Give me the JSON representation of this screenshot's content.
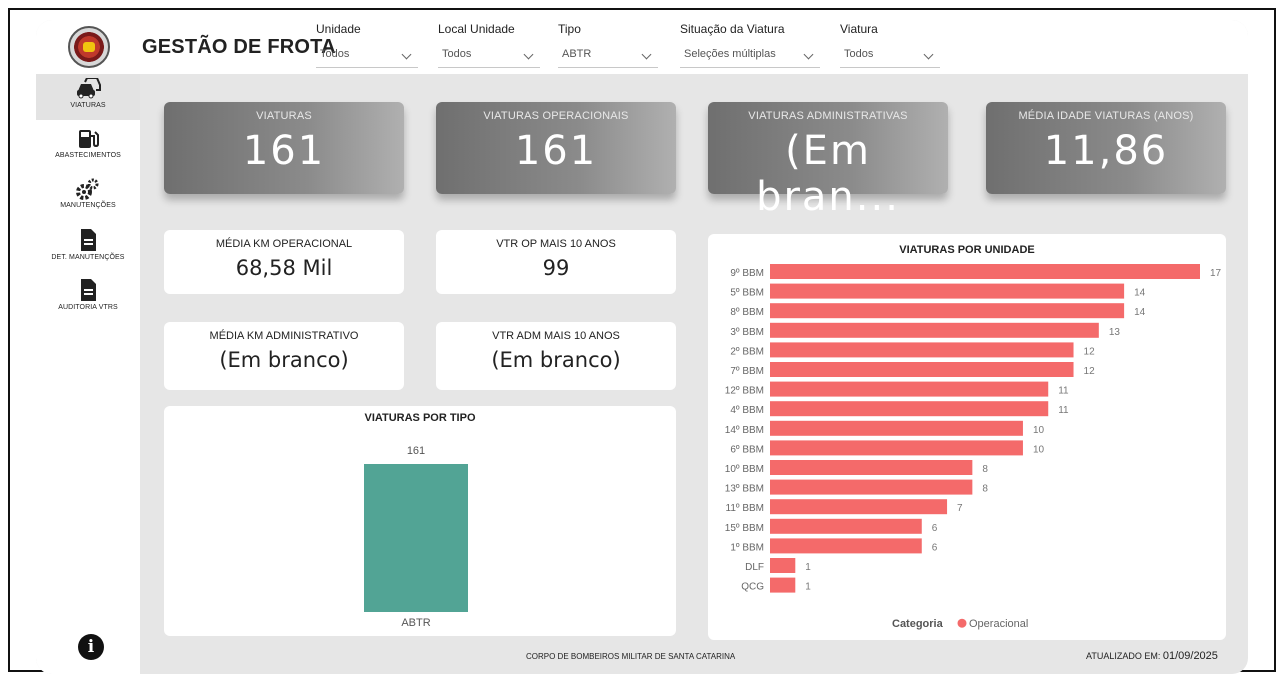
{
  "header": {
    "title": "GESTÃO DE FROTA",
    "filters": [
      {
        "label": "Unidade",
        "value": "Todos"
      },
      {
        "label": "Local Unidade",
        "value": "Todos"
      },
      {
        "label": "Tipo",
        "value": "ABTR"
      },
      {
        "label": "Situação da Viatura",
        "value": "Seleções múltiplas"
      },
      {
        "label": "Viatura",
        "value": "Todos"
      }
    ]
  },
  "sidebar": {
    "items": [
      {
        "label": "VIATURAS",
        "icon": "car-icon"
      },
      {
        "label": "ABASTECIMENTOS",
        "icon": "fuel-icon"
      },
      {
        "label": "MANUTENÇÕES",
        "icon": "gears-icon"
      },
      {
        "label": "DET. MANUTENÇÕES",
        "icon": "document-icon"
      },
      {
        "label": "AUDITORIA VTRS",
        "icon": "document-icon"
      }
    ],
    "info_icon": "info-icon"
  },
  "kpis": [
    {
      "label": "VIATURAS",
      "value": "161"
    },
    {
      "label": "VIATURAS OPERACIONAIS",
      "value": "161"
    },
    {
      "label": "VIATURAS ADMINISTRATIVAS",
      "value": "(Em bran..."
    },
    {
      "label": "MÉDIA IDADE VIATURAS (ANOS)",
      "value": "11,86"
    }
  ],
  "cards": [
    {
      "label": "MÉDIA KM OPERACIONAL",
      "value": "68,58 Mil"
    },
    {
      "label": "VTR OP MAIS 10 ANOS",
      "value": "99"
    },
    {
      "label": "MÉDIA KM ADMINISTRATIVO",
      "value": "(Em branco)"
    },
    {
      "label": "VTR ADM MAIS 10 ANOS",
      "value": "(Em branco)"
    }
  ],
  "chart_data": [
    {
      "type": "bar",
      "title": "VIATURAS POR TIPO",
      "categories": [
        "ABTR"
      ],
      "values": [
        161
      ],
      "color": "#52a495",
      "ylim": [
        0,
        161
      ]
    },
    {
      "type": "bar",
      "orientation": "horizontal",
      "title": "VIATURAS POR UNIDADE",
      "categories": [
        "9º BBM",
        "5º BBM",
        "8º BBM",
        "3º BBM",
        "2º BBM",
        "7º BBM",
        "12º BBM",
        "4º BBM",
        "14º BBM",
        "6º BBM",
        "10º BBM",
        "13º BBM",
        "11º BBM",
        "15º BBM",
        "1º BBM",
        "DLF",
        "QCG"
      ],
      "values": [
        17,
        14,
        14,
        13,
        12,
        12,
        11,
        11,
        10,
        10,
        8,
        8,
        7,
        6,
        6,
        1,
        1
      ],
      "color": "#f46a6a",
      "legend_title": "Categoria",
      "legend": [
        "Operacional"
      ],
      "legend_position": "bottom",
      "xlim": [
        0,
        17
      ]
    }
  ],
  "footer": {
    "center": "CORPO DE BOMBEIROS MILITAR DE SANTA CATARINA",
    "updated_label": "ATUALIZADO EM:",
    "updated_date": "01/09/2025"
  }
}
